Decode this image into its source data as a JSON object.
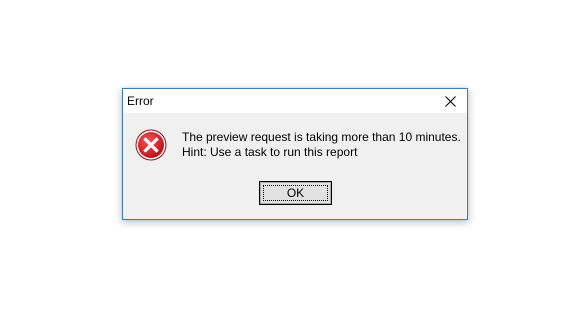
{
  "dialog": {
    "title": "Error",
    "close_icon": "close-icon",
    "status_icon": "error-icon",
    "status_color": "#d9272e",
    "message_lines": [
      "The preview request is taking more than 10 minutes.",
      "Hint: Use a task to run this report"
    ],
    "ok_label": "OK"
  },
  "colors": {
    "border": "#3c7fb1",
    "body": "#f0f0f0",
    "titlebar": "#ffffff"
  }
}
